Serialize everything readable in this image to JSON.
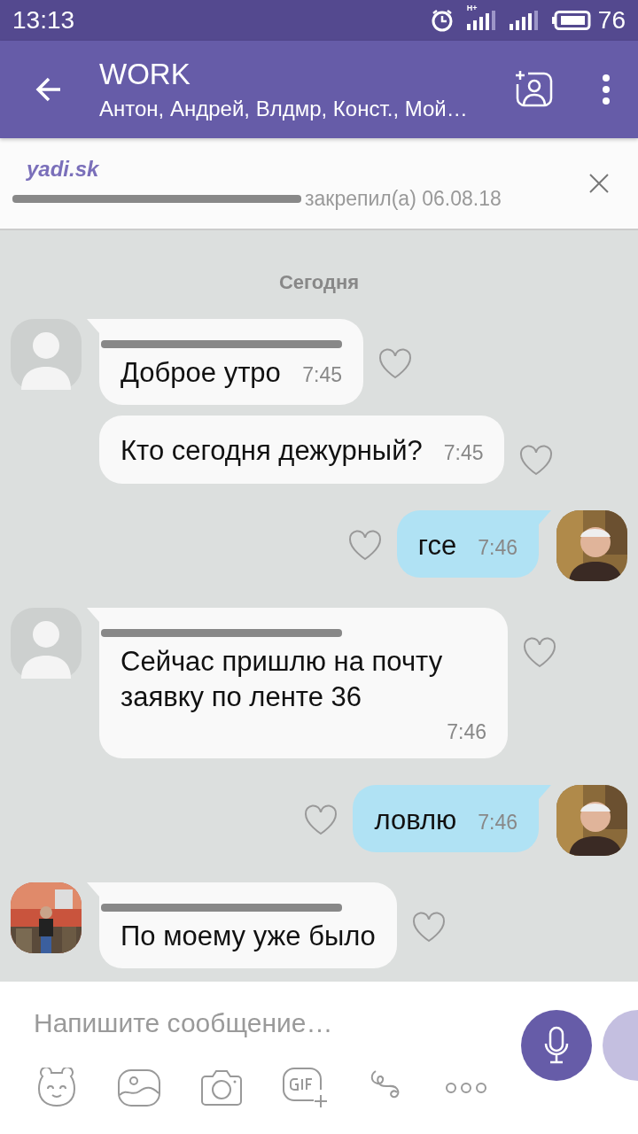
{
  "status_bar": {
    "time": "13:13",
    "network": "H+",
    "battery": "76"
  },
  "header": {
    "title": "WORK",
    "subtitle": "Антон, Андрей, Влдмр, Конст., Мой…"
  },
  "pinned": {
    "title": "yadi.sk",
    "author_redacted": true,
    "info": "закрепил(а) 06.08.18"
  },
  "messages": [
    {
      "kind": "date",
      "text": "Сегодня"
    },
    {
      "kind": "incoming",
      "avatar": {
        "kind": "placeholder"
      },
      "sender_redacted": true,
      "text": "Доброе утро",
      "time": "7:45"
    },
    {
      "kind": "incoming",
      "sender_redacted": false,
      "text": "Кто сегодня дежурный?",
      "time": "7:45"
    },
    {
      "kind": "outgoing",
      "text": "гсе",
      "time": "7:46"
    },
    {
      "kind": "incoming",
      "avatar": {
        "kind": "placeholder"
      },
      "sender_redacted": true,
      "text": "Сейчас пришлю на почту заявку по ленте 36",
      "time": "7:46"
    },
    {
      "kind": "outgoing",
      "text": "ловлю",
      "time": "7:46"
    },
    {
      "kind": "incoming",
      "sender_redacted": true,
      "text": "По моему уже было"
    }
  ],
  "composer": {
    "placeholder": "Напишите сообщение…"
  }
}
